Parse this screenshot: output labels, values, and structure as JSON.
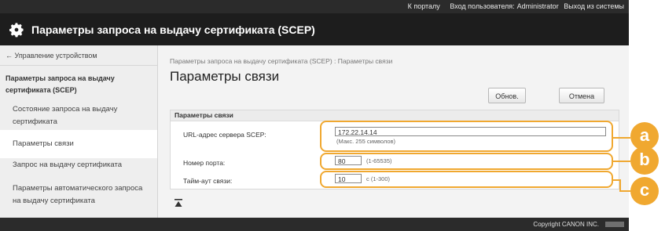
{
  "topbar": {
    "portal_link": "К порталу",
    "login_user_label": "Вход пользователя:",
    "user_name": "Administrator",
    "logout_link": "Выход из системы"
  },
  "header": {
    "title": "Параметры запроса на выдачу сертификата (SCEP)"
  },
  "sidebar": {
    "back_link": "← Управление устройством",
    "category": "Параметры запроса на выдачу сертификата (SCEP)",
    "items": [
      {
        "label": "Состояние запроса на выдачу сертификата",
        "active": false
      },
      {
        "label": "Параметры связи",
        "active": true
      },
      {
        "label": "Запрос на выдачу сертификата",
        "active": false
      },
      {
        "label": "Параметры автоматического запроса на выдачу сертификата",
        "active": false
      }
    ]
  },
  "main": {
    "breadcrumb": "Параметры запроса на выдачу сертификата (SCEP) : Параметры связи",
    "heading": "Параметры связи",
    "buttons": {
      "apply": "Обнов.",
      "cancel": "Отмена"
    },
    "panel": {
      "title": "Параметры связи",
      "url": {
        "label": "URL-адрес сервера SCEP:",
        "value": "172.22.14.14",
        "hint": "(Макс. 255 символов)"
      },
      "port": {
        "label": "Номер порта:",
        "value": "80",
        "hint": "(1-65535)"
      },
      "timeout": {
        "label": "Тайм-аут связи:",
        "value": "10",
        "hint": "с (1-300)"
      }
    }
  },
  "callouts": [
    "a",
    "b",
    "c"
  ],
  "footer": {
    "copyright": "Copyright CANON INC."
  },
  "colors": {
    "callout": "#f0a830",
    "titlebar": "#1d1d1d",
    "topbar": "#2b2b2b"
  }
}
